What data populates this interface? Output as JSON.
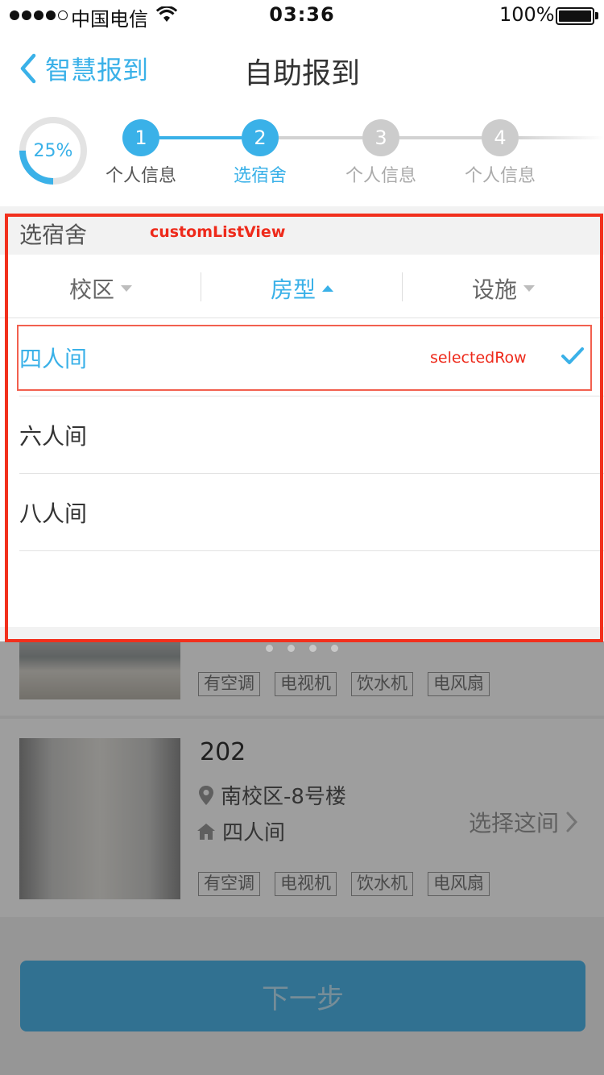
{
  "status_bar": {
    "carrier": "中国电信",
    "time": "03:36",
    "battery": "100%"
  },
  "nav": {
    "back_label": "智慧报到",
    "title": "自助报到"
  },
  "progress": {
    "percent_text": "25%",
    "percent_value": 0.25,
    "steps": [
      {
        "num": "1",
        "label": "个人信息",
        "state": "done"
      },
      {
        "num": "2",
        "label": "选宿舍",
        "state": "current"
      },
      {
        "num": "3",
        "label": "个人信息",
        "state": "todo"
      },
      {
        "num": "4",
        "label": "个人信息",
        "state": "todo"
      }
    ]
  },
  "popup": {
    "title": "选宿舍",
    "filters": [
      {
        "label": "校区",
        "state": "collapsed"
      },
      {
        "label": "房型",
        "state": "expanded"
      },
      {
        "label": "设施",
        "state": "collapsed"
      }
    ],
    "options": [
      {
        "label": "四人间",
        "selected": true
      },
      {
        "label": "六人间",
        "selected": false
      },
      {
        "label": "八人间",
        "selected": false
      }
    ]
  },
  "annotations": {
    "list_view": "customListView",
    "selected_row": "selectedRow"
  },
  "rooms": [
    {
      "tags": [
        "有空调",
        "电视机",
        "饮水机",
        "电风扇"
      ]
    },
    {
      "number": "202",
      "location": "南校区-8号楼",
      "room_type": "四人间",
      "choose_label": "选择这间",
      "tags": [
        "有空调",
        "电视机",
        "饮水机",
        "电风扇"
      ]
    }
  ],
  "next_button": "下一步",
  "colors": {
    "accent": "#3ab1e8",
    "inactive": "#cccccc",
    "annotation": "#f2301d"
  }
}
